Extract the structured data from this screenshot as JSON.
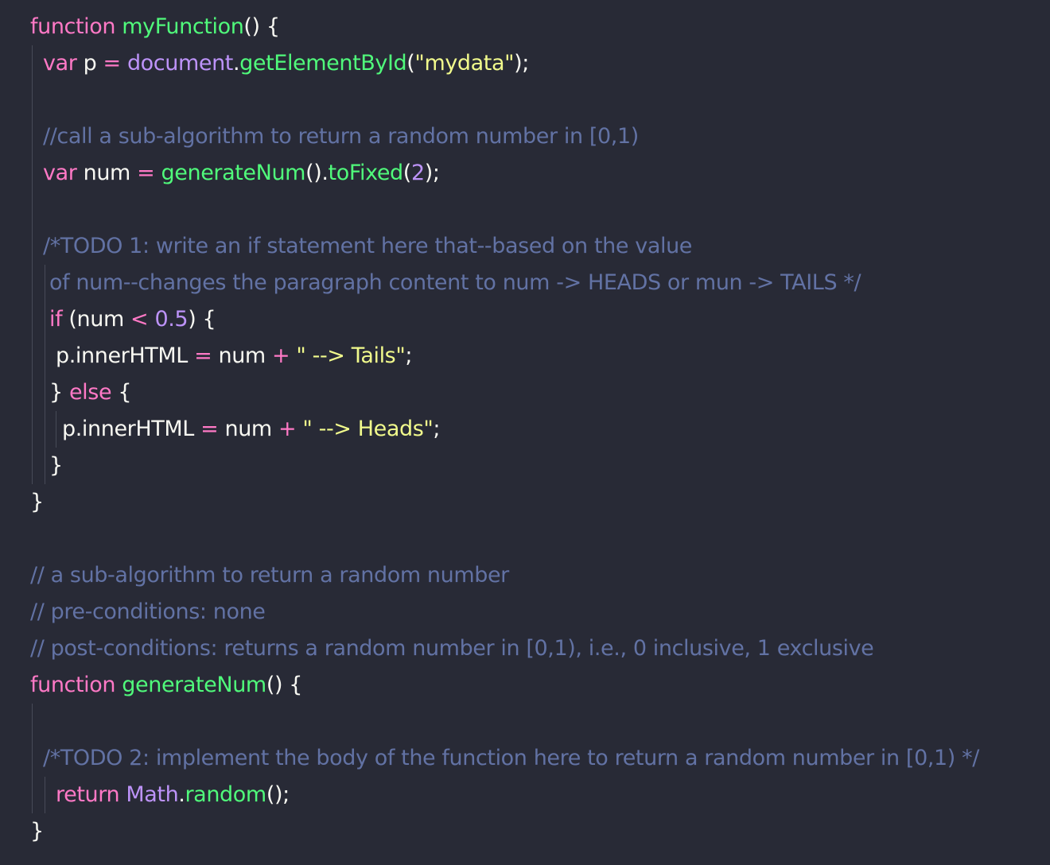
{
  "colors": {
    "background": "#282a36",
    "default": "#f8f8f2",
    "keyword": "#ff79c6",
    "function": "#50fa7b",
    "object": "#bd93f9",
    "string": "#f1fa8c",
    "number": "#bd93f9",
    "comment": "#6272a4",
    "guide": "#474a57"
  },
  "lines": [
    {
      "tokens": [
        [
          "keyword",
          "function "
        ],
        [
          "function",
          "myFunction"
        ],
        [
          "default",
          "() {"
        ]
      ]
    },
    {
      "tokens": [
        [
          "keyword",
          "var "
        ],
        [
          "default",
          "p "
        ],
        [
          "operator",
          "= "
        ],
        [
          "object",
          "document"
        ],
        [
          "default",
          "."
        ],
        [
          "function",
          "getElementById"
        ],
        [
          "default",
          "("
        ],
        [
          "string",
          "\"mydata\""
        ],
        [
          "default",
          ");"
        ]
      ]
    },
    {
      "tokens": []
    },
    {
      "tokens": [
        [
          "comment",
          "//call a sub-algorithm to return a random number in [0,1)"
        ]
      ]
    },
    {
      "tokens": [
        [
          "keyword",
          "var "
        ],
        [
          "default",
          "num "
        ],
        [
          "operator",
          "= "
        ],
        [
          "function",
          "generateNum"
        ],
        [
          "default",
          "()."
        ],
        [
          "function",
          "toFixed"
        ],
        [
          "default",
          "("
        ],
        [
          "number",
          "2"
        ],
        [
          "default",
          ");"
        ]
      ]
    },
    {
      "tokens": []
    },
    {
      "tokens": [
        [
          "comment",
          "/*TODO 1: write an if statement here that--based on the value"
        ]
      ]
    },
    {
      "tokens": [
        [
          "comment",
          "of num--changes the paragraph content to num -> HEADS or mun -> TAILS */"
        ]
      ]
    },
    {
      "tokens": [
        [
          "keyword",
          "if "
        ],
        [
          "default",
          "(num "
        ],
        [
          "operator",
          "< "
        ],
        [
          "number",
          "0.5"
        ],
        [
          "default",
          ") {"
        ]
      ]
    },
    {
      "tokens": [
        [
          "default",
          "p.innerHTML "
        ],
        [
          "operator",
          "= "
        ],
        [
          "default",
          "num "
        ],
        [
          "operator",
          "+ "
        ],
        [
          "string",
          "\" --> Tails\""
        ],
        [
          "default",
          ";"
        ]
      ]
    },
    {
      "tokens": [
        [
          "default",
          "} "
        ],
        [
          "keyword",
          "else "
        ],
        [
          "default",
          "{"
        ]
      ]
    },
    {
      "tokens": [
        [
          "default",
          "p.innerHTML "
        ],
        [
          "operator",
          "= "
        ],
        [
          "default",
          "num "
        ],
        [
          "operator",
          "+ "
        ],
        [
          "string",
          "\" --> Heads\""
        ],
        [
          "default",
          ";"
        ]
      ]
    },
    {
      "tokens": [
        [
          "default",
          "}"
        ]
      ]
    },
    {
      "tokens": [
        [
          "default",
          "}"
        ]
      ]
    },
    {
      "tokens": []
    },
    {
      "tokens": [
        [
          "comment",
          "// a sub-algorithm to return a random number"
        ]
      ]
    },
    {
      "tokens": [
        [
          "comment",
          "// pre-conditions: none"
        ]
      ]
    },
    {
      "tokens": [
        [
          "comment",
          "// post-conditions: returns a random number in [0,1), i.e., 0 inclusive, 1 exclusive"
        ]
      ]
    },
    {
      "tokens": [
        [
          "keyword",
          "function "
        ],
        [
          "function",
          "generateNum"
        ],
        [
          "default",
          "() {"
        ]
      ]
    },
    {
      "tokens": []
    },
    {
      "tokens": [
        [
          "comment",
          "/*TODO 2: implement the body of the function here to return a random number in [0,1) */"
        ]
      ]
    },
    {
      "tokens": [
        [
          "keyword",
          "return "
        ],
        [
          "object",
          "Math"
        ],
        [
          "default",
          "."
        ],
        [
          "function",
          "random"
        ],
        [
          "default",
          "();"
        ]
      ]
    },
    {
      "tokens": [
        [
          "default",
          "}"
        ]
      ]
    }
  ]
}
